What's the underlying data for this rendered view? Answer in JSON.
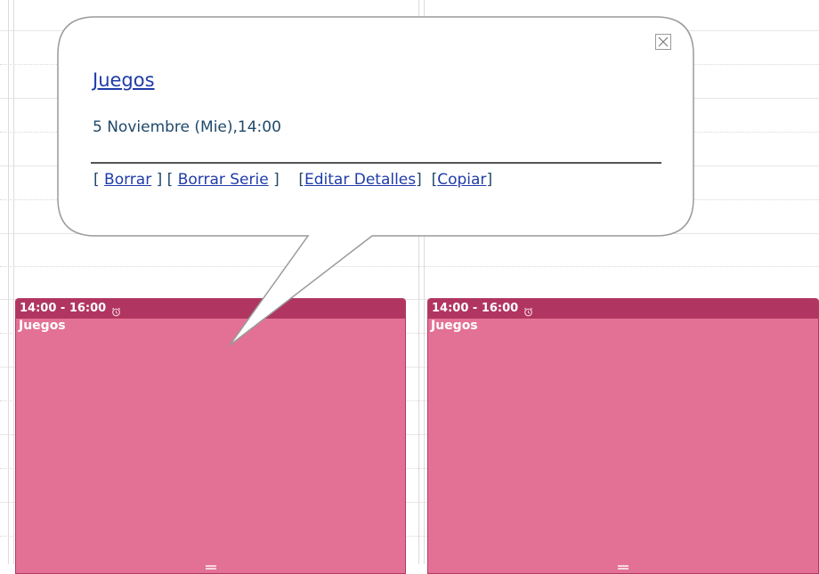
{
  "popup": {
    "title": "Juegos",
    "date": "5 Noviembre (Mie),14:00",
    "actions": {
      "delete": "Borrar",
      "delete_series": "Borrar Serie",
      "edit_details": "Editar Detalles",
      "copy": "Copiar"
    },
    "close_icon": "close-icon"
  },
  "events": [
    {
      "time": "14:00 - 16:00",
      "title": "Juegos",
      "icon": "alarm-icon"
    },
    {
      "time": "14:00 - 16:00",
      "title": "Juegos",
      "icon": "alarm-icon"
    }
  ],
  "colors": {
    "event_body": "#e37195",
    "event_header": "#b03560",
    "link": "#1f3ca8"
  }
}
